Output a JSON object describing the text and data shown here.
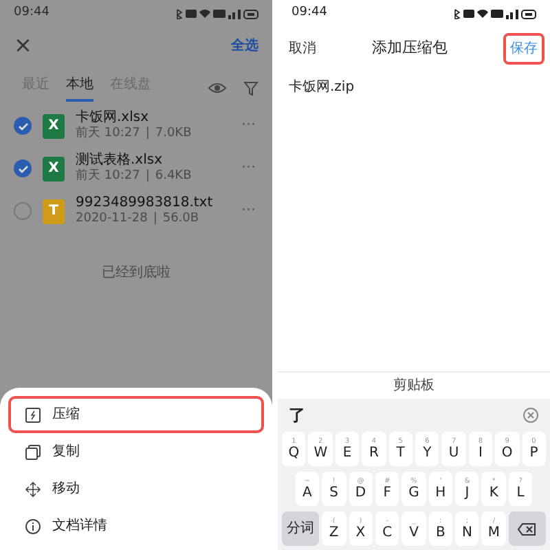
{
  "left_screen": {
    "status_time": "09:44",
    "close": "×",
    "select_all": "全选",
    "tabs": [
      {
        "label": "最近",
        "selected": false
      },
      {
        "label": "本地",
        "selected": true
      },
      {
        "label": "在线盘",
        "selected": false
      }
    ],
    "files": [
      {
        "name": "卡饭网.xlsx",
        "date": "前天 10:27",
        "separator": "|",
        "size": "7.0KB",
        "checked": true,
        "kind": "excel",
        "icon_letter": "X",
        "more": "···"
      },
      {
        "name": "测试表格.xlsx",
        "date": "前天 10:27",
        "separator": "|",
        "size": "6.4KB",
        "checked": true,
        "kind": "excel",
        "icon_letter": "X",
        "more": "···"
      },
      {
        "name": "9923489983818.txt",
        "date": "2020-11-28",
        "separator": "|",
        "size": "56.0B",
        "checked": false,
        "kind": "text",
        "icon_letter": "T",
        "more": "···"
      }
    ],
    "end_note": "已经到底啦",
    "sheet_items": [
      {
        "label": "压缩",
        "kind": "compress",
        "highlighted": true
      },
      {
        "label": "复制",
        "kind": "copy",
        "highlighted": false
      },
      {
        "label": "移动",
        "kind": "move",
        "highlighted": false
      },
      {
        "label": "文档详情",
        "kind": "info",
        "highlighted": false
      }
    ]
  },
  "right_screen": {
    "status_time": "09:44",
    "cancel": "取消",
    "title": "添加压缩包",
    "save": {
      "label": "保存",
      "highlighted": true
    },
    "filename": "卡饭网.zip",
    "clipboard": "剪贴板",
    "candidate": "了",
    "keyboard_rows": [
      [
        {
          "kind": "letter",
          "label": "Q",
          "hint": "1"
        },
        {
          "kind": "letter",
          "label": "W",
          "hint": "2"
        },
        {
          "kind": "letter",
          "label": "E",
          "hint": "3"
        },
        {
          "kind": "letter",
          "label": "R",
          "hint": "4"
        },
        {
          "kind": "letter",
          "label": "T",
          "hint": "5"
        },
        {
          "kind": "letter",
          "label": "Y",
          "hint": "6"
        },
        {
          "kind": "letter",
          "label": "U",
          "hint": "7"
        },
        {
          "kind": "letter",
          "label": "I",
          "hint": "8"
        },
        {
          "kind": "letter",
          "label": "O",
          "hint": "9"
        },
        {
          "kind": "letter",
          "label": "P",
          "hint": "0"
        }
      ],
      [
        {
          "kind": "letter",
          "label": "A",
          "hint": "~"
        },
        {
          "kind": "letter",
          "label": "S",
          "hint": "!"
        },
        {
          "kind": "letter",
          "label": "D",
          "hint": "@"
        },
        {
          "kind": "letter",
          "label": "F",
          "hint": "#"
        },
        {
          "kind": "letter",
          "label": "G",
          "hint": "%"
        },
        {
          "kind": "letter",
          "label": "H",
          "hint": "'"
        },
        {
          "kind": "letter",
          "label": "J",
          "hint": "&"
        },
        {
          "kind": "letter",
          "label": "K",
          "hint": "*"
        },
        {
          "kind": "letter",
          "label": "L",
          "hint": "?"
        }
      ],
      [
        {
          "kind": "function",
          "label": "分词"
        },
        {
          "kind": "letter",
          "label": "Z",
          "hint": "("
        },
        {
          "kind": "letter",
          "label": "X",
          "hint": ")"
        },
        {
          "kind": "letter",
          "label": "C",
          "hint": "-"
        },
        {
          "kind": "letter",
          "label": "V",
          "hint": "_"
        },
        {
          "kind": "letter",
          "label": "B",
          "hint": ":"
        },
        {
          "kind": "letter",
          "label": "N",
          "hint": ";"
        },
        {
          "kind": "letter",
          "label": "M",
          "hint": "/"
        },
        {
          "kind": "backspace"
        }
      ]
    ]
  }
}
